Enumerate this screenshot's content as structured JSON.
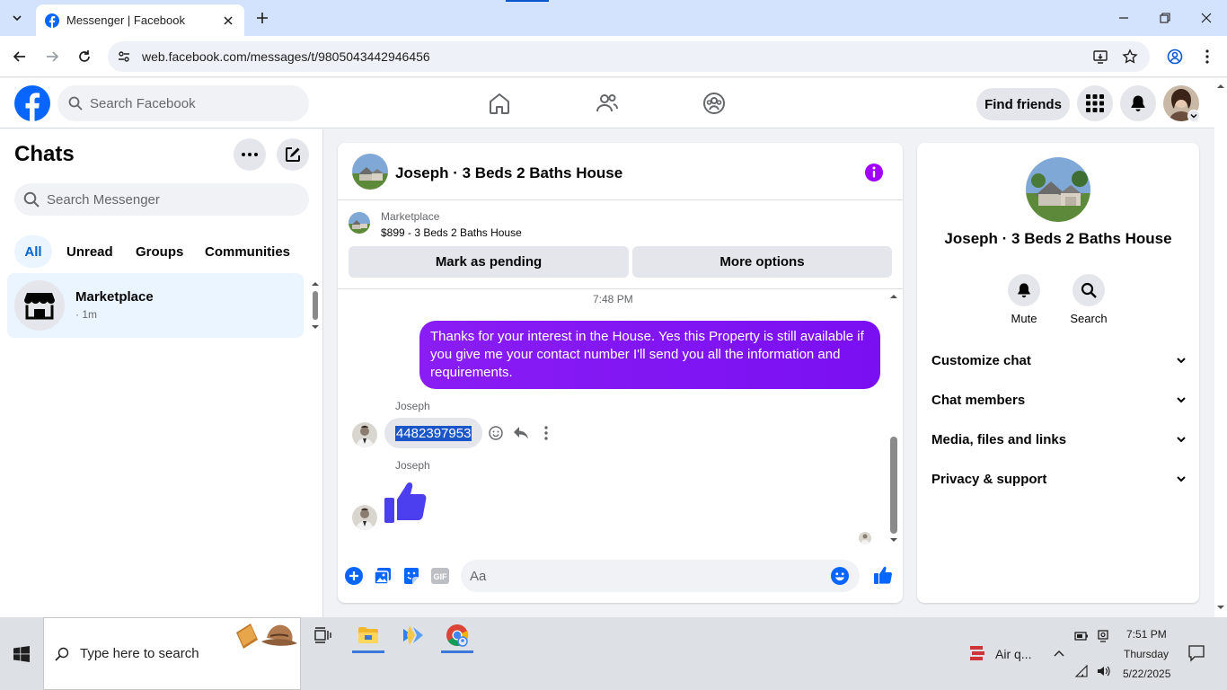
{
  "browser": {
    "tab_title": "Messenger | Facebook",
    "url": "web.facebook.com/messages/t/9805043442946456"
  },
  "fb_header": {
    "search_placeholder": "Search Facebook",
    "find_friends_label": "Find friends"
  },
  "sidebar": {
    "title": "Chats",
    "search_placeholder": "Search Messenger",
    "filters": [
      "All",
      "Unread",
      "Groups",
      "Communities"
    ],
    "active_filter": "All",
    "chats": [
      {
        "name": "Marketplace",
        "meta": "· 1m"
      }
    ]
  },
  "conversation": {
    "title": "Joseph · 3 Beds 2 Baths House",
    "marketplace_label": "Marketplace",
    "listing": "$899 - 3 Beds 2 Baths House",
    "mark_pending_label": "Mark as pending",
    "more_options_label": "More options",
    "timestamp": "7:48 PM",
    "outgoing_message": "Thanks for your interest in the House. Yes this Property is still available if you give me your contact number I'll send you all the information and requirements.",
    "sender_name_1": "Joseph",
    "incoming_message": "4482397953",
    "sender_name_2": "Joseph",
    "composer_placeholder": "Aa"
  },
  "right_panel": {
    "name": "Joseph · 3 Beds 2 Baths House",
    "mute_label": "Mute",
    "search_label": "Search",
    "sections": [
      "Customize chat",
      "Chat members",
      "Media, files and links",
      "Privacy & support"
    ]
  },
  "taskbar": {
    "search_placeholder": "Type here to search",
    "weather": "Air q...",
    "time": "7:51 PM",
    "day": "Thursday",
    "date": "5/22/2025"
  },
  "colors": {
    "fb_blue": "#0866ff",
    "messenger_purple": "#8a1df4",
    "active_tab_bg": "#ebf5ff",
    "selection_blue": "#1a56c8"
  }
}
